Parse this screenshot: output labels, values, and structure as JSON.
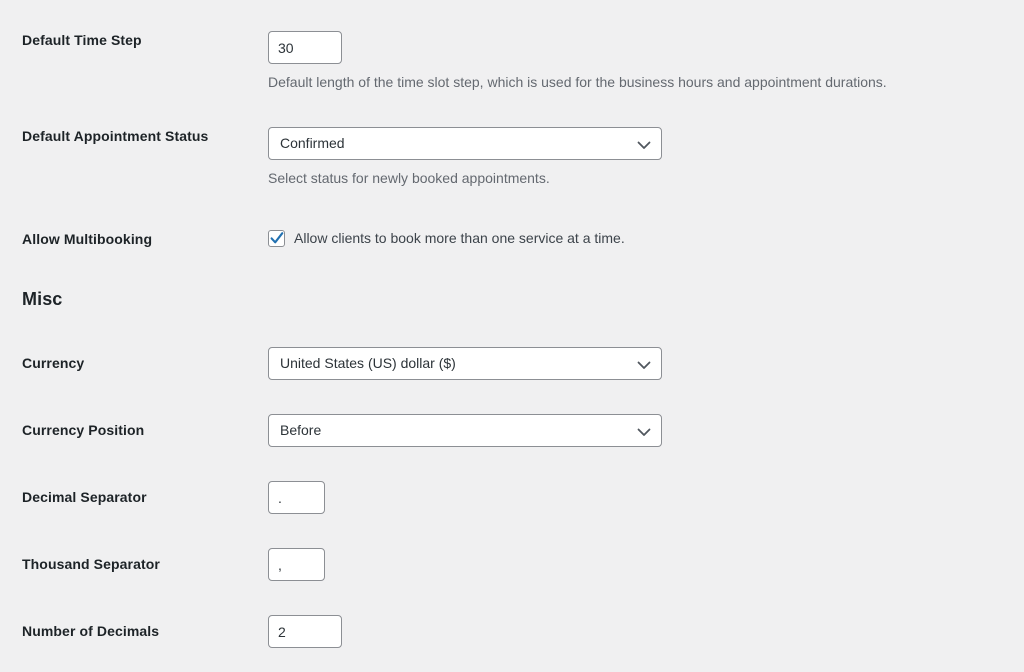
{
  "fields": [
    {
      "label": "Default Time Step",
      "control": "text",
      "value": "30",
      "description": "Default length of the time slot step, which is used for the business hours and appointment durations."
    },
    {
      "label": "Default Appointment Status",
      "control": "select",
      "value": "Confirmed",
      "description": "Select status for newly booked appointments."
    },
    {
      "label": "Allow Multibooking",
      "control": "checkbox",
      "checked": true,
      "checkbox_label": "Allow clients to book more than one service at a time."
    }
  ],
  "section": {
    "heading": "Misc"
  },
  "misc_fields": [
    {
      "label": "Currency",
      "control": "select",
      "value": "United States (US) dollar ($)"
    },
    {
      "label": "Currency Position",
      "control": "select",
      "value": "Before"
    },
    {
      "label": "Decimal Separator",
      "control": "text",
      "value": "."
    },
    {
      "label": "Thousand Separator",
      "control": "text",
      "value": ","
    },
    {
      "label": "Number of Decimals",
      "control": "text",
      "value": "2"
    }
  ],
  "icons": {
    "chevron": "chevron-down-icon",
    "check": "check-icon"
  },
  "colors": {
    "background": "#f0f0f1",
    "label_text": "#1d2327",
    "description_text": "#646970",
    "input_border": "#8c8f94",
    "input_background": "#ffffff",
    "checkbox_accent": "#2271b1"
  }
}
